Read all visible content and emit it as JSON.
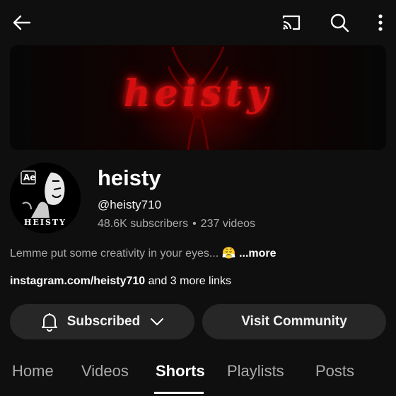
{
  "banner": {
    "text": "heisty"
  },
  "channel": {
    "name": "heisty",
    "handle": "@heisty710",
    "subscribers": "48.6K subscribers",
    "separator": "•",
    "videos": "237 videos",
    "description": "Lemme put some creativity in your eyes...",
    "description_emoji": "😤",
    "more_label": "...more",
    "link_primary": "instagram.com/heisty710",
    "link_suffix": " and 3 more links"
  },
  "avatar": {
    "badge": "Ae",
    "caption": "HEISTY"
  },
  "actions": {
    "subscribed_label": "Subscribed",
    "community_label": "Visit Community"
  },
  "tabs": [
    {
      "label": "Home"
    },
    {
      "label": "Videos"
    },
    {
      "label": "Shorts",
      "active": true
    },
    {
      "label": "Playlists"
    },
    {
      "label": "Posts"
    }
  ],
  "icons": {
    "back": "arrow-left",
    "cast": "cast",
    "search": "search",
    "more": "more-vertical",
    "bell": "bell",
    "chevron": "chevron-down"
  },
  "colors": {
    "background": "#0f0f0f",
    "pill": "#272727",
    "banner_red": "#d50f0f",
    "secondary_text": "#aaaaaa"
  }
}
